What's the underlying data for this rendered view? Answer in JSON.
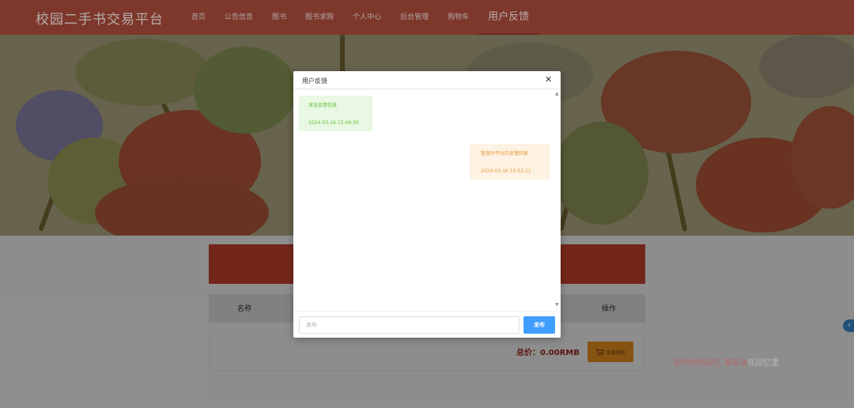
{
  "header": {
    "brand": "校园二手书交易平台",
    "nav": [
      {
        "label": "首页"
      },
      {
        "label": "公告信息"
      },
      {
        "label": "图书"
      },
      {
        "label": "图书求购"
      },
      {
        "label": "个人中心"
      },
      {
        "label": "后台管理"
      },
      {
        "label": "购物车"
      },
      {
        "label": "用户反馈"
      }
    ],
    "active_nav": "用户反馈"
  },
  "cart": {
    "columns": {
      "name": "名称",
      "operation": "操作"
    },
    "total_text": "总价：0.00RMB",
    "buy_label": "点击购买"
  },
  "marquee": {
    "part1": "回中你的回忆 渐渐淡",
    "part2": "在回忆里"
  },
  "modal": {
    "title": "用户反馈",
    "close_symbol": "✕",
    "messages": [
      {
        "side": "left",
        "text": "发送反馈信息",
        "time": "2024-03-16 15:49:30"
      },
      {
        "side": "right",
        "text": "管理对平台的反馈回复",
        "time": "2024-03-16 15:52:11"
      }
    ],
    "input_placeholder": "发布",
    "post_label": "发布"
  },
  "colors": {
    "header_bg": "#a84a3a",
    "accent_red": "#9a3424",
    "post_button": "#409eff",
    "buy_button": "#b36f18",
    "msg_left_text": "#63c23a",
    "msg_right_text": "#e69a3c"
  },
  "icons": {
    "close": "close-icon",
    "cart": "cart-icon",
    "side_toggle": "chevron-left-icon",
    "scroll_up": "caret-up-icon",
    "scroll_down": "caret-down-icon"
  }
}
